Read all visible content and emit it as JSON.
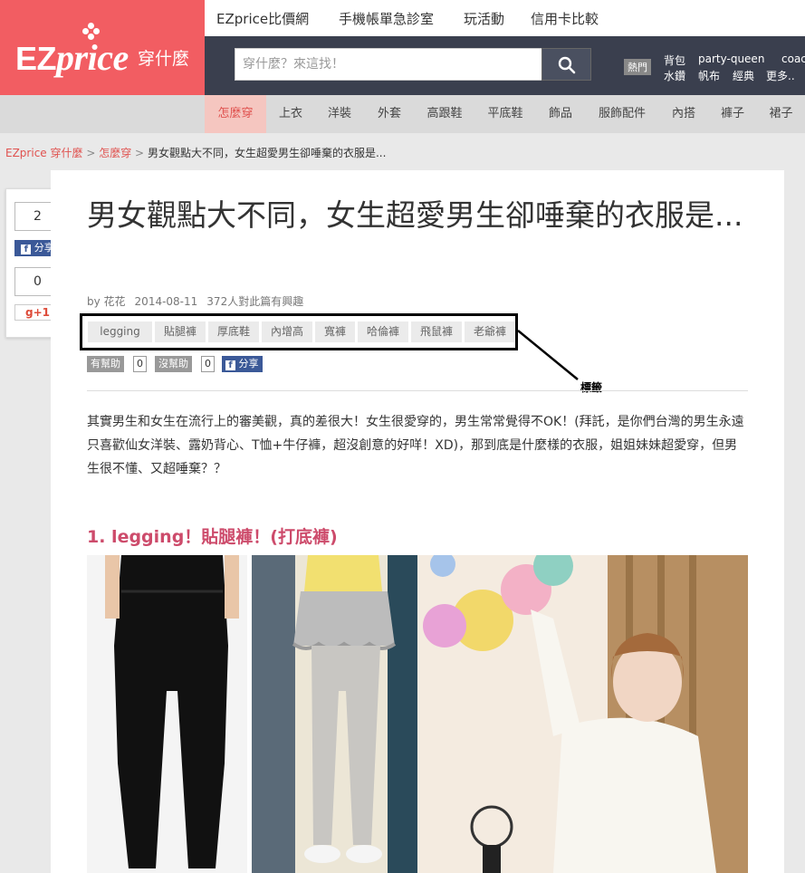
{
  "logo": {
    "brand_main": "EZ",
    "brand_accent": "price",
    "sub": "穿什麼"
  },
  "topnav": [
    "EZprice比價網",
    "手機帳單急診室",
    "玩活動",
    "信用卡比較"
  ],
  "search": {
    "placeholder": "穿什麼？來這找！"
  },
  "hot": {
    "badge": "熱門",
    "row1": [
      "背包",
      "party-queen",
      "coac"
    ],
    "row2": [
      "水鑽",
      "帆布",
      "經典",
      "更多.."
    ]
  },
  "categories": [
    "怎麼穿",
    "上衣",
    "洋裝",
    "外套",
    "高跟鞋",
    "平底鞋",
    "飾品",
    "服飾配件",
    "內搭",
    "褲子",
    "裙子"
  ],
  "breadcrumb": {
    "home": "EZprice 穿什麼",
    "sep1": ">",
    "section": "怎麼穿",
    "sep2": ">",
    "current": "男女觀點大不同，女生超愛男生卻唾棄的衣服是..."
  },
  "share_sidebar": {
    "fb_count": "2",
    "fb_label": "分享",
    "gplus_count": "0",
    "gplus_label": "+1"
  },
  "article": {
    "title": "男女觀點大不同，女生超愛男生卻唾棄的衣服是...",
    "author": "by 花花",
    "date": "2014-08-11",
    "interest": "372人對此篇有興趣",
    "tags": [
      "legging",
      "貼腿褲",
      "厚底鞋",
      "內增高",
      "寬褲",
      "哈倫褲",
      "飛鼠褲",
      "老爺褲"
    ],
    "annotation": "標籤",
    "helpful_label": "有幫助",
    "helpful_count": "0",
    "unhelpful_label": "沒幫助",
    "unhelpful_count": "0",
    "share_label": "分享",
    "intro": "其實男生和女生在流行上的審美觀，真的差很大！女生很愛穿的，男生常常覺得不OK！(拜託，是你們台灣的男生永遠只喜歡仙女洋裝、露奶背心、T恤+牛仔褲，超沒創意的好咩！XD)，那到底是什麼樣的衣服，姐姐妹妹超愛穿，但男生很不懂、又超唾棄？？",
    "section_heading": "1. legging！貼腿褲！(打底褲)"
  },
  "colors": {
    "brand": "#f25d62",
    "header_dark": "#3a3f4e",
    "accent": "#e0524f",
    "heading": "#cd4b6b",
    "facebook": "#3b5998"
  }
}
